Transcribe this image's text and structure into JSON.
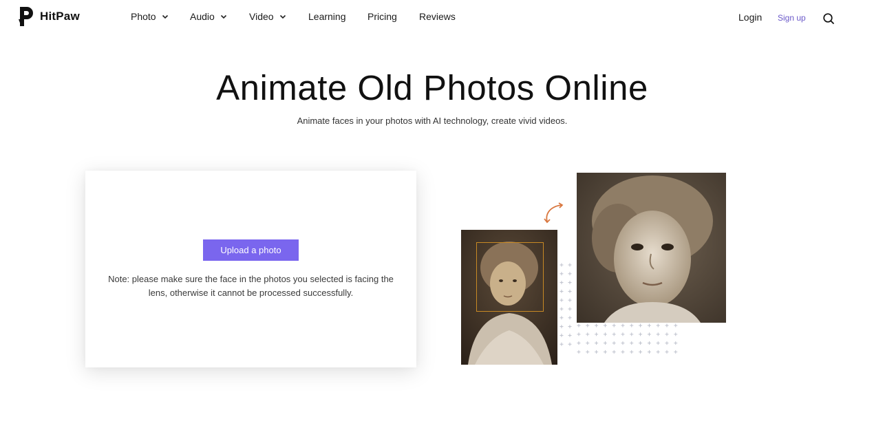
{
  "brand": {
    "name": "HitPaw"
  },
  "nav": {
    "items": [
      {
        "label": "Photo",
        "has_dropdown": true
      },
      {
        "label": "Audio",
        "has_dropdown": true
      },
      {
        "label": "Video",
        "has_dropdown": true
      },
      {
        "label": "Learning",
        "has_dropdown": false
      },
      {
        "label": "Pricing",
        "has_dropdown": false
      },
      {
        "label": "Reviews",
        "has_dropdown": false
      }
    ],
    "login_label": "Login",
    "signup_label": "Sign up",
    "search_icon": "search-icon"
  },
  "hero": {
    "title": "Animate Old Photos Online",
    "subtitle": "Animate faces in your photos with AI technology, create vivid videos."
  },
  "upload": {
    "button_label": "Upload a photo",
    "note": "Note: please make sure the face in the photos you selected is facing the lens, otherwise it cannot be processed successfully."
  },
  "colors": {
    "accent": "#7a66ee",
    "signup": "#6b59c9",
    "face_box": "#c98a24",
    "arrow": "#d9773f"
  }
}
